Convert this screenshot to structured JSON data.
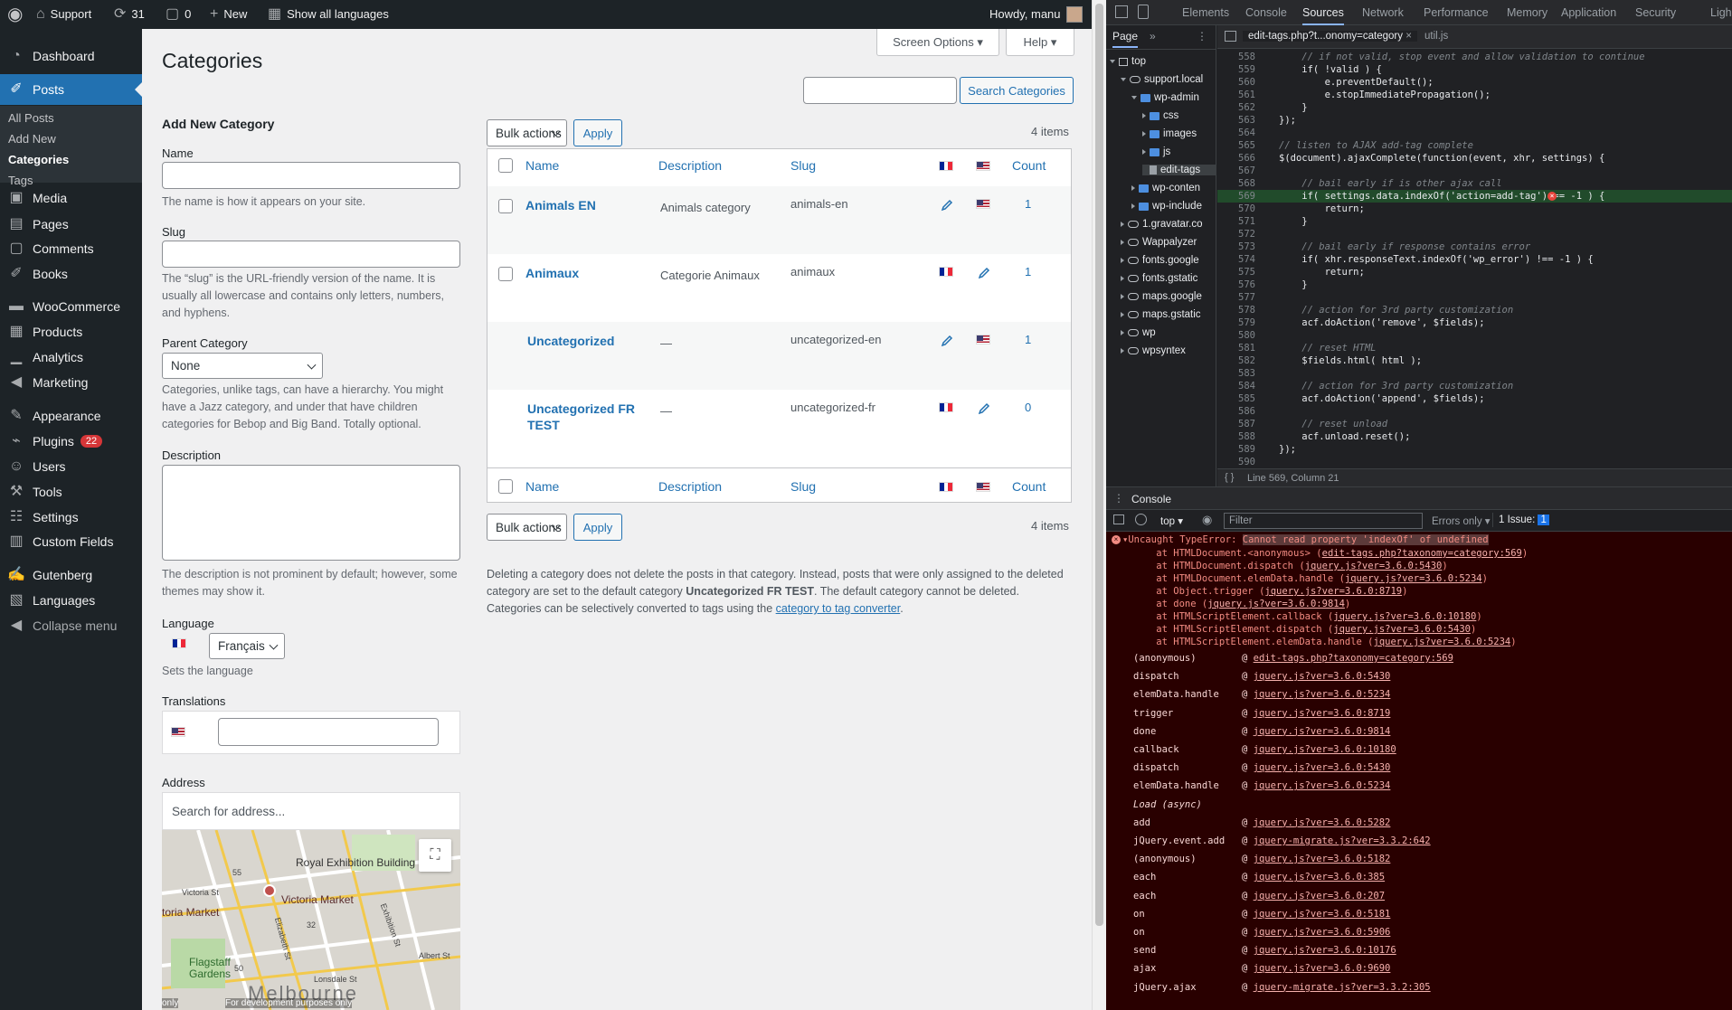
{
  "adminbar": {
    "site": "Support",
    "updates": "31",
    "comments": "0",
    "new": "New",
    "languages": "Show all languages",
    "howdy": "Howdy, manu"
  },
  "sidebar": {
    "items": [
      {
        "label": "Dashboard",
        "icon": "dashboard-icon"
      },
      {
        "label": "Posts",
        "icon": "pin-icon"
      },
      {
        "label": "Media",
        "icon": "media-icon"
      },
      {
        "label": "Pages",
        "icon": "pages-icon"
      },
      {
        "label": "Comments",
        "icon": "comments-icon"
      },
      {
        "label": "Books",
        "icon": "pin-icon"
      },
      {
        "label": "WooCommerce",
        "icon": "woo-icon"
      },
      {
        "label": "Products",
        "icon": "products-icon"
      },
      {
        "label": "Analytics",
        "icon": "analytics-icon"
      },
      {
        "label": "Marketing",
        "icon": "megaphone-icon"
      },
      {
        "label": "Appearance",
        "icon": "brush-icon"
      },
      {
        "label": "Plugins",
        "icon": "plugin-icon",
        "badge": "22"
      },
      {
        "label": "Users",
        "icon": "users-icon"
      },
      {
        "label": "Tools",
        "icon": "tools-icon"
      },
      {
        "label": "Settings",
        "icon": "settings-icon"
      },
      {
        "label": "Custom Fields",
        "icon": "fields-icon"
      },
      {
        "label": "Gutenberg",
        "icon": "gutenberg-icon"
      },
      {
        "label": "Languages",
        "icon": "languages-icon"
      },
      {
        "label": "Collapse menu",
        "icon": "collapse-icon"
      }
    ],
    "posts_sub": [
      "All Posts",
      "Add New",
      "Categories",
      "Tags"
    ]
  },
  "page": {
    "title": "Categories",
    "screen_options": "Screen Options",
    "help": "Help",
    "search_button": "Search Categories",
    "search_value": ""
  },
  "form": {
    "heading": "Add New Category",
    "name_label": "Name",
    "name_help": "The name is how it appears on your site.",
    "slug_label": "Slug",
    "slug_help": "The “slug” is the URL-friendly version of the name. It is usually all lowercase and contains only letters, numbers, and hyphens.",
    "parent_label": "Parent Category",
    "parent_value": "None",
    "parent_help": "Categories, unlike tags, can have a hierarchy. You might have a Jazz category, and under that have children categories for Bebop and Big Band. Totally optional.",
    "desc_label": "Description",
    "desc_help": "The description is not prominent by default; however, some themes may show it.",
    "lang_label": "Language",
    "lang_value": "Français",
    "lang_help": "Sets the language",
    "trans_label": "Translations",
    "address_label": "Address",
    "address_placeholder": "Search for address...",
    "map_labels": [
      "Royal Exhibition Building",
      "Victoria Market",
      "Victoria St",
      "toria Market",
      "Flagstaff Gardens",
      "Melbourne",
      "Albert St",
      "Exhibition St",
      "Lonsdale St",
      "Elizabeth St",
      "55",
      "32",
      "50",
      "For development purposes only",
      "only"
    ]
  },
  "table": {
    "bulk": "Bulk actions",
    "apply": "Apply",
    "count_text": "4 items",
    "headers": {
      "name": "Name",
      "description": "Description",
      "slug": "Slug",
      "count": "Count"
    },
    "rows": [
      {
        "name": "Animals EN",
        "description": "Animals category",
        "slug": "animals-en",
        "count": "1"
      },
      {
        "name": "Animaux",
        "description": "Categorie Animaux",
        "slug": "animaux",
        "count": "1"
      },
      {
        "name": "Uncategorized",
        "description": "—",
        "slug": "uncategorized-en",
        "count": "1"
      },
      {
        "name": "Uncategorized FR TEST",
        "description": "—",
        "slug": "uncategorized-fr",
        "count": "0"
      }
    ]
  },
  "notes": {
    "p1_a": "Deleting a category does not delete the posts in that category. Instead, posts that were only assigned to the deleted category are set to the default category ",
    "p1_b": "Uncategorized FR TEST",
    "p1_c": ". The default category cannot be deleted.",
    "p2_a": "Categories can be selectively converted to tags using the ",
    "p2_link": "category to tag converter",
    "p2_b": "."
  },
  "devtools": {
    "tabs": [
      "Elements",
      "Console",
      "Sources",
      "Network",
      "Performance",
      "Memory",
      "Application",
      "Security",
      "Ligh"
    ],
    "active_tab": "Sources",
    "nav_tab": "Page",
    "file_tabs": [
      "edit-tags.php?t...onomy=category",
      "util.js"
    ],
    "tree": [
      {
        "label": "top",
        "kind": "frame",
        "depth": 0
      },
      {
        "label": "support.local",
        "kind": "cloud",
        "depth": 1
      },
      {
        "label": "wp-admin",
        "kind": "folder",
        "depth": 2
      },
      {
        "label": "css",
        "kind": "folder",
        "depth": 3
      },
      {
        "label": "images",
        "kind": "folder",
        "depth": 3
      },
      {
        "label": "js",
        "kind": "folder",
        "depth": 3
      },
      {
        "label": "edit-tags",
        "kind": "file",
        "depth": 3
      },
      {
        "label": "wp-conten",
        "kind": "folder",
        "depth": 2
      },
      {
        "label": "wp-include",
        "kind": "folder",
        "depth": 2
      },
      {
        "label": "1.gravatar.co",
        "kind": "cloud",
        "depth": 1
      },
      {
        "label": "Wappalyzer",
        "kind": "cloud",
        "depth": 1
      },
      {
        "label": "fonts.google",
        "kind": "cloud",
        "depth": 1
      },
      {
        "label": "fonts.gstatic",
        "kind": "cloud",
        "depth": 1
      },
      {
        "label": "maps.google",
        "kind": "cloud",
        "depth": 1
      },
      {
        "label": "maps.gstatic",
        "kind": "cloud",
        "depth": 1
      },
      {
        "label": "wp",
        "kind": "cloud",
        "depth": 1
      },
      {
        "label": "wpsyntex",
        "kind": "cloud",
        "depth": 1
      }
    ],
    "code": [
      {
        "n": "558",
        "t": "    // if not valid, stop event and allow validation to continue"
      },
      {
        "n": "559",
        "t": "    if( !valid ) {"
      },
      {
        "n": "560",
        "t": "        e.preventDefault();"
      },
      {
        "n": "561",
        "t": "        e.stopImmediatePropagation();"
      },
      {
        "n": "562",
        "t": "    }"
      },
      {
        "n": "563",
        "t": "});"
      },
      {
        "n": "564",
        "t": ""
      },
      {
        "n": "565",
        "t": "// listen to AJAX add-tag complete"
      },
      {
        "n": "566",
        "t": "$(document).ajaxComplete(function(event, xhr, settings) {"
      },
      {
        "n": "567",
        "t": ""
      },
      {
        "n": "568",
        "t": "    // bail early if is other ajax call"
      },
      {
        "n": "569",
        "t": "    if( settings.data.indexOf('action=add-tag') == -1 ) {"
      },
      {
        "n": "570",
        "t": "        return;"
      },
      {
        "n": "571",
        "t": "    }"
      },
      {
        "n": "572",
        "t": ""
      },
      {
        "n": "573",
        "t": "    // bail early if response contains error"
      },
      {
        "n": "574",
        "t": "    if( xhr.responseText.indexOf('wp_error') !== -1 ) {"
      },
      {
        "n": "575",
        "t": "        return;"
      },
      {
        "n": "576",
        "t": "    }"
      },
      {
        "n": "577",
        "t": ""
      },
      {
        "n": "578",
        "t": "    // action for 3rd party customization"
      },
      {
        "n": "579",
        "t": "    acf.doAction('remove', $fields);"
      },
      {
        "n": "580",
        "t": ""
      },
      {
        "n": "581",
        "t": "    // reset HTML"
      },
      {
        "n": "582",
        "t": "    $fields.html( html );"
      },
      {
        "n": "583",
        "t": ""
      },
      {
        "n": "584",
        "t": "    // action for 3rd party customization"
      },
      {
        "n": "585",
        "t": "    acf.doAction('append', $fields);"
      },
      {
        "n": "586",
        "t": ""
      },
      {
        "n": "587",
        "t": "    // reset unload"
      },
      {
        "n": "588",
        "t": "    acf.unload.reset();"
      },
      {
        "n": "589",
        "t": "});"
      },
      {
        "n": "590",
        "t": ""
      }
    ],
    "status": "Line 569, Column 21",
    "console_tab": "Console",
    "context": "top",
    "filter_placeholder": "Filter",
    "levels": "Errors only",
    "issues": "1 Issue:",
    "issues_count": "1",
    "error_title_a": "Uncaught TypeError: ",
    "error_title_b": "Cannot read property 'indexOf' of undefined",
    "error_stack": [
      {
        "pre": "    at HTMLDocument.<anonymous> (",
        "link": "edit-tags.php?taxonomy=category:569",
        "post": ")"
      },
      {
        "pre": "    at HTMLDocument.dispatch (",
        "link": "jquery.js?ver=3.6.0:5430",
        "post": ")"
      },
      {
        "pre": "    at HTMLDocument.elemData.handle (",
        "link": "jquery.js?ver=3.6.0:5234",
        "post": ")"
      },
      {
        "pre": "    at Object.trigger (",
        "link": "jquery.js?ver=3.6.0:8719",
        "post": ")"
      },
      {
        "pre": "    at done (",
        "link": "jquery.js?ver=3.6.0:9814",
        "post": ")"
      },
      {
        "pre": "    at HTMLScriptElement.callback (",
        "link": "jquery.js?ver=3.6.0:10180",
        "post": ")"
      },
      {
        "pre": "    at HTMLScriptElement.dispatch (",
        "link": "jquery.js?ver=3.6.0:5430",
        "post": ")"
      },
      {
        "pre": "    at HTMLScriptElement.elemData.handle (",
        "link": "jquery.js?ver=3.6.0:5234",
        "post": ")"
      }
    ],
    "call_stack": [
      {
        "fn": "(anonymous)",
        "link": "edit-tags.php?taxonomy=category:569"
      },
      {
        "fn": "dispatch",
        "link": "jquery.js?ver=3.6.0:5430"
      },
      {
        "fn": "elemData.handle",
        "link": "jquery.js?ver=3.6.0:5234"
      },
      {
        "fn": "trigger",
        "link": "jquery.js?ver=3.6.0:8719"
      },
      {
        "fn": "done",
        "link": "jquery.js?ver=3.6.0:9814"
      },
      {
        "fn": "callback",
        "link": "jquery.js?ver=3.6.0:10180"
      },
      {
        "fn": "dispatch",
        "link": "jquery.js?ver=3.6.0:5430"
      },
      {
        "fn": "elemData.handle",
        "link": "jquery.js?ver=3.6.0:5234"
      },
      {
        "fn": "Load (async)",
        "link": ""
      },
      {
        "fn": "add",
        "link": "jquery.js?ver=3.6.0:5282"
      },
      {
        "fn": "jQuery.event.add",
        "link": "jquery-migrate.js?ver=3.3.2:642"
      },
      {
        "fn": "(anonymous)",
        "link": "jquery.js?ver=3.6.0:5182"
      },
      {
        "fn": "each",
        "link": "jquery.js?ver=3.6.0:385"
      },
      {
        "fn": "each",
        "link": "jquery.js?ver=3.6.0:207"
      },
      {
        "fn": "on",
        "link": "jquery.js?ver=3.6.0:5181"
      },
      {
        "fn": "on",
        "link": "jquery.js?ver=3.6.0:5906"
      },
      {
        "fn": "send",
        "link": "jquery.js?ver=3.6.0:10176"
      },
      {
        "fn": "ajax",
        "link": "jquery.js?ver=3.6.0:9690"
      },
      {
        "fn": "jQuery.ajax",
        "link": "jquery-migrate.js?ver=3.3.2:305"
      }
    ]
  }
}
